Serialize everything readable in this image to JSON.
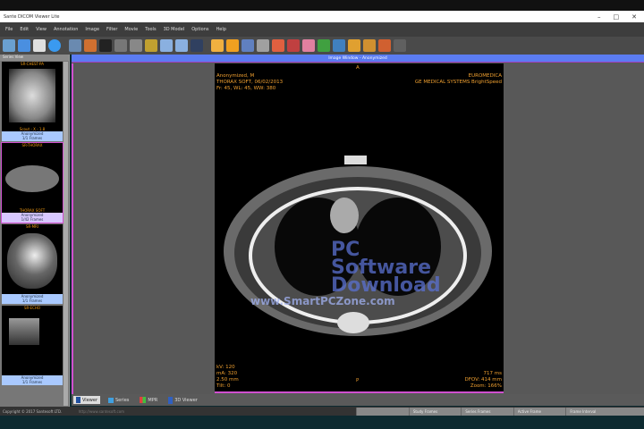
{
  "title": "Sante DICOM Viewer Lite",
  "menu": [
    "File",
    "Edit",
    "View",
    "Annotation",
    "Image",
    "Filter",
    "Movie",
    "Tools",
    "3D Model",
    "Options",
    "Help"
  ],
  "left_panel": {
    "header": "Series View",
    "thumbs": [
      {
        "top": "SR-CHEST-PA",
        "bottom": "Scout - X - 1.8",
        "label1": "Anonymized",
        "label2": "1/1 Frames"
      },
      {
        "top": "SR-THORAX",
        "bottom": "THORAX SOFT",
        "label1": "Anonymized",
        "label2": "1/42 Frames"
      },
      {
        "top": "SR-MRI",
        "bottom": "",
        "label1": "Anonymized",
        "label2": "1/1 Frames"
      },
      {
        "top": "SR-ECHO",
        "bottom": "",
        "label1": "Anonymized",
        "label2": "1/1 Frames"
      }
    ]
  },
  "window": {
    "title": "Image Window - Anonymized",
    "top_marker": "A",
    "bottom_marker": "P",
    "tl": [
      "Anonymized, M",
      "THORAX SOFT, 06/02/2013",
      "Fr: 45, WL: 45, WW: 380"
    ],
    "tr": [
      "EUROMEDICA",
      "GE MEDICAL SYSTEMS BrightSpeed"
    ],
    "bl": [
      "kV: 120",
      "mA: 320",
      "2.50 mm",
      "Tilt: 0"
    ],
    "br": [
      "717 ms",
      "DFOV: 414 mm",
      "Zoom: 166%"
    ]
  },
  "tabs": [
    "Viewer",
    "Series",
    "MPR",
    "3D Viewer"
  ],
  "status": {
    "copyright": "Copyright © 2017 Santesoft LTD.",
    "link": "http://www.santesoft.com",
    "fields": [
      "",
      "Study Frames",
      "Series Frames",
      "Active Frame",
      "Frame Interval"
    ]
  },
  "watermark": [
    "PC",
    "Software",
    "Download",
    "www.SmartPCZone.com"
  ],
  "colors": {
    "accent": "#5b7cf2",
    "overlay": "#f0a030",
    "active_border": "#d050d0"
  }
}
